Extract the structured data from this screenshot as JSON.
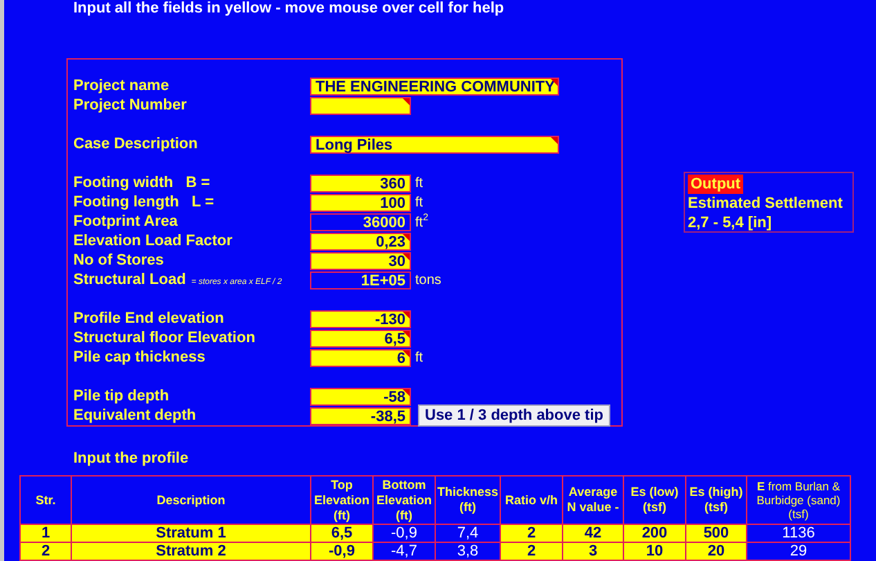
{
  "instruction": "Input all the fields in yellow - move mouse over cell for help",
  "groups": [
    [
      {
        "label": "Project name",
        "value": "THE ENGINEERING COMMUNITY",
        "kind": "input",
        "wide": true,
        "comment": true
      },
      {
        "label": "Project Number",
        "kind": "input",
        "wide": false,
        "comment": true
      }
    ],
    [
      {
        "label": "Case Description",
        "value": "Long Piles",
        "kind": "input",
        "wide": true,
        "comment": true
      }
    ],
    [
      {
        "label": "Footing width   B =",
        "value": "360",
        "unit": "ft",
        "kind": "input",
        "wide": false,
        "comment": false
      },
      {
        "label": "Footing length   L =",
        "value": "100",
        "unit": "ft",
        "kind": "input",
        "wide": false,
        "comment": false
      },
      {
        "label": "Footprint Area",
        "value": "36000",
        "unit": "ft$^{2}$",
        "kind": "computed",
        "wide": false,
        "comment": false
      },
      {
        "label": "Elevation Load Factor",
        "value": "0,23",
        "kind": "input",
        "wide": false,
        "comment": true
      },
      {
        "label": "No of Stores",
        "value": "30",
        "kind": "input",
        "wide": false,
        "comment": true
      },
      {
        "label": "Structural Load",
        "note": "= stores x area x ELF / 2",
        "value": "1E+05",
        "unit": "tons",
        "kind": "computed",
        "wide": false,
        "comment": false
      }
    ],
    [
      {
        "label": "Profile End elevation",
        "value": "-130",
        "kind": "input",
        "wide": false,
        "comment": true
      },
      {
        "label": "Structural floor Elevation",
        "value": "6,5",
        "kind": "input",
        "wide": false,
        "comment": true
      },
      {
        "label": "Pile cap thickness",
        "value": "6",
        "unit": "ft",
        "kind": "input",
        "wide": false,
        "comment": true
      }
    ],
    [
      {
        "label": "Pile tip depth",
        "value": "-58",
        "kind": "input",
        "wide": false,
        "comment": true
      },
      {
        "label": "Equivalent depth",
        "value": "-38,5",
        "kind": "input",
        "wide": false,
        "comment": false,
        "button": "Use 1 / 3 depth above tip"
      }
    ]
  ],
  "output": {
    "title": "Output",
    "label": "Estimated Settlement",
    "value": "2,7 - 5,4 [in]"
  },
  "profile": {
    "title": "Input the profile",
    "columns": [
      "Str.",
      "Description",
      "Top Elevation (ft)",
      "Bottom Elevation (ft)",
      "Thickness (ft)",
      "Ratio v/h",
      "Average N value -",
      "Es (low) (tsf)",
      "Es (high) (tsf)",
      "**E** from Burlan & Burbidge (sand) (tsf)"
    ],
    "rows": [
      [
        {
          "text": "1",
          "kind": "input"
        },
        {
          "text": "Stratum 1",
          "kind": "input"
        },
        {
          "text": "6,5",
          "kind": "input"
        },
        {
          "text": "-0,9",
          "kind": "computed"
        },
        {
          "text": "7,4",
          "kind": "computed"
        },
        {
          "text": "2",
          "kind": "input"
        },
        {
          "text": "42",
          "kind": "input"
        },
        {
          "text": "200",
          "kind": "input"
        },
        {
          "text": "500",
          "kind": "input"
        },
        {
          "text": "1136",
          "kind": "computed"
        }
      ],
      [
        {
          "text": "2",
          "kind": "input"
        },
        {
          "text": "Stratum 2",
          "kind": "input"
        },
        {
          "text": "-0,9",
          "kind": "input"
        },
        {
          "text": "-4,7",
          "kind": "computed"
        },
        {
          "text": "3,8",
          "kind": "computed"
        },
        {
          "text": "2",
          "kind": "input"
        },
        {
          "text": "3",
          "kind": "input"
        },
        {
          "text": "10",
          "kind": "input"
        },
        {
          "text": "20",
          "kind": "input"
        },
        {
          "text": "29",
          "kind": "computed"
        }
      ]
    ]
  }
}
